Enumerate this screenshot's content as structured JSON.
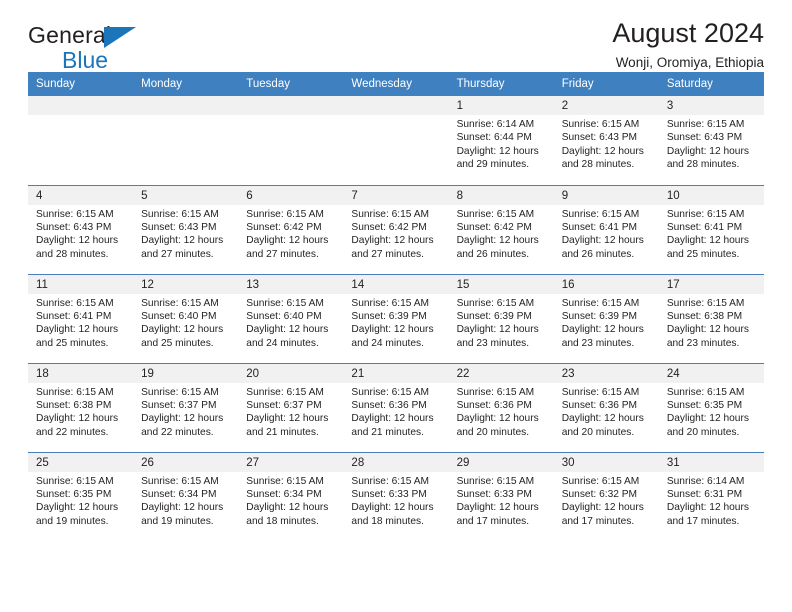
{
  "brand": {
    "name_top": "General",
    "name_bottom": "Blue",
    "triangle_color": "#1b75bb"
  },
  "header": {
    "title": "August 2024",
    "subtitle": "Wonji, Oromiya, Ethiopia"
  },
  "theme": {
    "header_bg": "#3f80c0",
    "daynum_bg": "#f1f1f1",
    "row_divider": "#4a7ebb",
    "text": "#231f20"
  },
  "weekdays": [
    "Sunday",
    "Monday",
    "Tuesday",
    "Wednesday",
    "Thursday",
    "Friday",
    "Saturday"
  ],
  "weeks": [
    [
      {
        "day": "",
        "blank": true,
        "sunrise": "",
        "sunset": "",
        "daylight1": "",
        "daylight2": ""
      },
      {
        "day": "",
        "blank": true,
        "sunrise": "",
        "sunset": "",
        "daylight1": "",
        "daylight2": ""
      },
      {
        "day": "",
        "blank": true,
        "sunrise": "",
        "sunset": "",
        "daylight1": "",
        "daylight2": ""
      },
      {
        "day": "",
        "blank": true,
        "sunrise": "",
        "sunset": "",
        "daylight1": "",
        "daylight2": ""
      },
      {
        "day": "1",
        "blank": false,
        "sunrise": "Sunrise: 6:14 AM",
        "sunset": "Sunset: 6:44 PM",
        "daylight1": "Daylight: 12 hours",
        "daylight2": "and 29 minutes."
      },
      {
        "day": "2",
        "blank": false,
        "sunrise": "Sunrise: 6:15 AM",
        "sunset": "Sunset: 6:43 PM",
        "daylight1": "Daylight: 12 hours",
        "daylight2": "and 28 minutes."
      },
      {
        "day": "3",
        "blank": false,
        "sunrise": "Sunrise: 6:15 AM",
        "sunset": "Sunset: 6:43 PM",
        "daylight1": "Daylight: 12 hours",
        "daylight2": "and 28 minutes."
      }
    ],
    [
      {
        "day": "4",
        "blank": false,
        "sunrise": "Sunrise: 6:15 AM",
        "sunset": "Sunset: 6:43 PM",
        "daylight1": "Daylight: 12 hours",
        "daylight2": "and 28 minutes."
      },
      {
        "day": "5",
        "blank": false,
        "sunrise": "Sunrise: 6:15 AM",
        "sunset": "Sunset: 6:43 PM",
        "daylight1": "Daylight: 12 hours",
        "daylight2": "and 27 minutes."
      },
      {
        "day": "6",
        "blank": false,
        "sunrise": "Sunrise: 6:15 AM",
        "sunset": "Sunset: 6:42 PM",
        "daylight1": "Daylight: 12 hours",
        "daylight2": "and 27 minutes."
      },
      {
        "day": "7",
        "blank": false,
        "sunrise": "Sunrise: 6:15 AM",
        "sunset": "Sunset: 6:42 PM",
        "daylight1": "Daylight: 12 hours",
        "daylight2": "and 27 minutes."
      },
      {
        "day": "8",
        "blank": false,
        "sunrise": "Sunrise: 6:15 AM",
        "sunset": "Sunset: 6:42 PM",
        "daylight1": "Daylight: 12 hours",
        "daylight2": "and 26 minutes."
      },
      {
        "day": "9",
        "blank": false,
        "sunrise": "Sunrise: 6:15 AM",
        "sunset": "Sunset: 6:41 PM",
        "daylight1": "Daylight: 12 hours",
        "daylight2": "and 26 minutes."
      },
      {
        "day": "10",
        "blank": false,
        "sunrise": "Sunrise: 6:15 AM",
        "sunset": "Sunset: 6:41 PM",
        "daylight1": "Daylight: 12 hours",
        "daylight2": "and 25 minutes."
      }
    ],
    [
      {
        "day": "11",
        "blank": false,
        "sunrise": "Sunrise: 6:15 AM",
        "sunset": "Sunset: 6:41 PM",
        "daylight1": "Daylight: 12 hours",
        "daylight2": "and 25 minutes."
      },
      {
        "day": "12",
        "blank": false,
        "sunrise": "Sunrise: 6:15 AM",
        "sunset": "Sunset: 6:40 PM",
        "daylight1": "Daylight: 12 hours",
        "daylight2": "and 25 minutes."
      },
      {
        "day": "13",
        "blank": false,
        "sunrise": "Sunrise: 6:15 AM",
        "sunset": "Sunset: 6:40 PM",
        "daylight1": "Daylight: 12 hours",
        "daylight2": "and 24 minutes."
      },
      {
        "day": "14",
        "blank": false,
        "sunrise": "Sunrise: 6:15 AM",
        "sunset": "Sunset: 6:39 PM",
        "daylight1": "Daylight: 12 hours",
        "daylight2": "and 24 minutes."
      },
      {
        "day": "15",
        "blank": false,
        "sunrise": "Sunrise: 6:15 AM",
        "sunset": "Sunset: 6:39 PM",
        "daylight1": "Daylight: 12 hours",
        "daylight2": "and 23 minutes."
      },
      {
        "day": "16",
        "blank": false,
        "sunrise": "Sunrise: 6:15 AM",
        "sunset": "Sunset: 6:39 PM",
        "daylight1": "Daylight: 12 hours",
        "daylight2": "and 23 minutes."
      },
      {
        "day": "17",
        "blank": false,
        "sunrise": "Sunrise: 6:15 AM",
        "sunset": "Sunset: 6:38 PM",
        "daylight1": "Daylight: 12 hours",
        "daylight2": "and 23 minutes."
      }
    ],
    [
      {
        "day": "18",
        "blank": false,
        "sunrise": "Sunrise: 6:15 AM",
        "sunset": "Sunset: 6:38 PM",
        "daylight1": "Daylight: 12 hours",
        "daylight2": "and 22 minutes."
      },
      {
        "day": "19",
        "blank": false,
        "sunrise": "Sunrise: 6:15 AM",
        "sunset": "Sunset: 6:37 PM",
        "daylight1": "Daylight: 12 hours",
        "daylight2": "and 22 minutes."
      },
      {
        "day": "20",
        "blank": false,
        "sunrise": "Sunrise: 6:15 AM",
        "sunset": "Sunset: 6:37 PM",
        "daylight1": "Daylight: 12 hours",
        "daylight2": "and 21 minutes."
      },
      {
        "day": "21",
        "blank": false,
        "sunrise": "Sunrise: 6:15 AM",
        "sunset": "Sunset: 6:36 PM",
        "daylight1": "Daylight: 12 hours",
        "daylight2": "and 21 minutes."
      },
      {
        "day": "22",
        "blank": false,
        "sunrise": "Sunrise: 6:15 AM",
        "sunset": "Sunset: 6:36 PM",
        "daylight1": "Daylight: 12 hours",
        "daylight2": "and 20 minutes."
      },
      {
        "day": "23",
        "blank": false,
        "sunrise": "Sunrise: 6:15 AM",
        "sunset": "Sunset: 6:36 PM",
        "daylight1": "Daylight: 12 hours",
        "daylight2": "and 20 minutes."
      },
      {
        "day": "24",
        "blank": false,
        "sunrise": "Sunrise: 6:15 AM",
        "sunset": "Sunset: 6:35 PM",
        "daylight1": "Daylight: 12 hours",
        "daylight2": "and 20 minutes."
      }
    ],
    [
      {
        "day": "25",
        "blank": false,
        "sunrise": "Sunrise: 6:15 AM",
        "sunset": "Sunset: 6:35 PM",
        "daylight1": "Daylight: 12 hours",
        "daylight2": "and 19 minutes."
      },
      {
        "day": "26",
        "blank": false,
        "sunrise": "Sunrise: 6:15 AM",
        "sunset": "Sunset: 6:34 PM",
        "daylight1": "Daylight: 12 hours",
        "daylight2": "and 19 minutes."
      },
      {
        "day": "27",
        "blank": false,
        "sunrise": "Sunrise: 6:15 AM",
        "sunset": "Sunset: 6:34 PM",
        "daylight1": "Daylight: 12 hours",
        "daylight2": "and 18 minutes."
      },
      {
        "day": "28",
        "blank": false,
        "sunrise": "Sunrise: 6:15 AM",
        "sunset": "Sunset: 6:33 PM",
        "daylight1": "Daylight: 12 hours",
        "daylight2": "and 18 minutes."
      },
      {
        "day": "29",
        "blank": false,
        "sunrise": "Sunrise: 6:15 AM",
        "sunset": "Sunset: 6:33 PM",
        "daylight1": "Daylight: 12 hours",
        "daylight2": "and 17 minutes."
      },
      {
        "day": "30",
        "blank": false,
        "sunrise": "Sunrise: 6:15 AM",
        "sunset": "Sunset: 6:32 PM",
        "daylight1": "Daylight: 12 hours",
        "daylight2": "and 17 minutes."
      },
      {
        "day": "31",
        "blank": false,
        "sunrise": "Sunrise: 6:14 AM",
        "sunset": "Sunset: 6:31 PM",
        "daylight1": "Daylight: 12 hours",
        "daylight2": "and 17 minutes."
      }
    ]
  ]
}
